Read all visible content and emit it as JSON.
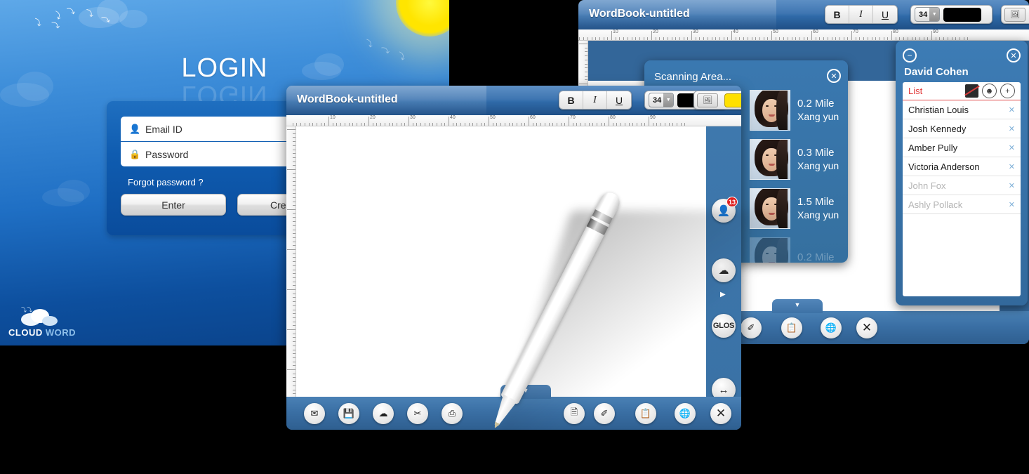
{
  "login": {
    "title": "LOGIN",
    "email_placeholder": "Email ID",
    "password_placeholder": "Password",
    "forgot_label": "Forgot password ?",
    "enter_label": "Enter",
    "create_label": "Create N",
    "logo_word1": "CLOUD",
    "logo_word2": "WORD",
    "accent": "#0d4f9e"
  },
  "wordbook_back": {
    "title": "WordBook-untitled",
    "toolbar": {
      "bold": "B",
      "italic": "I",
      "underline": "U",
      "font_size": "34",
      "caret": "▼",
      "text_color": "#000000",
      "highlight_color": "#ffe000",
      "image_icon": "🖼"
    },
    "ruler_labels": [
      "10",
      "20",
      "30",
      "40",
      "50",
      "60",
      "70",
      "80",
      "90"
    ],
    "bottom_icons_right": [
      "document-search",
      "pen",
      "clipboard",
      "globe",
      "close"
    ]
  },
  "wordbook_main": {
    "title": "WordBook-untitled",
    "toolbar": {
      "bold": "B",
      "italic": "I",
      "underline": "U",
      "font_size": "34",
      "caret": "▼",
      "text_color": "#000000",
      "highlight_color": "#ffe000",
      "image_icon": "🖼"
    },
    "ruler_labels": [
      "10",
      "20",
      "30",
      "40",
      "50",
      "60",
      "70",
      "80",
      "90"
    ],
    "rail": {
      "contacts_badge": "13",
      "glossary_label": "GLOS",
      "expand_arrow": "▶"
    },
    "bottom_icons_left": [
      "mail",
      "save",
      "cloud-upload",
      "cut",
      "print"
    ],
    "bottom_icons_right": [
      "document-search",
      "pen",
      "clipboard",
      "globe",
      "close"
    ],
    "drop_tab_caret": "▼"
  },
  "scanning": {
    "title": "Scanning Area...",
    "close": "✕",
    "more_arrow": "▶",
    "results": [
      {
        "distance": "0.2 Mile",
        "name": "Xang yun",
        "faded": false
      },
      {
        "distance": "0.3 Mile",
        "name": "Xang yun",
        "faded": false
      },
      {
        "distance": "1.5 Mile",
        "name": "Xang yun",
        "faded": false
      },
      {
        "distance": "0.2 Mile",
        "name": "",
        "faded": true
      }
    ]
  },
  "contact": {
    "minimize": "−",
    "close": "✕",
    "owner": "David Cohen",
    "list_label": "List",
    "list_label_color": "#e23c3c",
    "header_icons": [
      "camera-off",
      "person-add",
      "plus"
    ],
    "plus_glyph": "+",
    "person_glyph": "☻",
    "remove_glyph": "✕",
    "members": [
      {
        "name": "Christian Louis",
        "muted": false
      },
      {
        "name": "Josh Kennedy",
        "muted": false
      },
      {
        "name": "Amber Pully",
        "muted": false
      },
      {
        "name": "Victoria Anderson",
        "muted": false
      },
      {
        "name": "John Fox",
        "muted": true
      },
      {
        "name": "Ashly Pollack",
        "muted": true
      }
    ]
  },
  "icons": {
    "user": "👤",
    "lock": "🔒",
    "mail": "✉",
    "save": "💾",
    "cloud": "☁",
    "cut": "✂",
    "print": "⎙",
    "doc_search": "🗎",
    "pen": "✐",
    "clipboard": "📋",
    "globe": "🌐",
    "close": "✕",
    "arrows": "↔",
    "bird": "⤳"
  }
}
